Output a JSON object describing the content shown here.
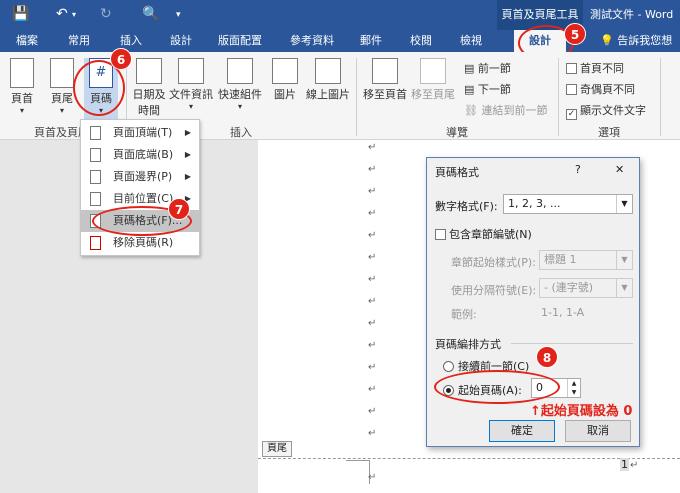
{
  "titlebar": {
    "context_tab": "頁首及頁尾工具",
    "document_title": "測試文件 - Word"
  },
  "tabs": [
    "檔案",
    "常用",
    "插入",
    "設計",
    "版面配置",
    "參考資料",
    "郵件",
    "校閱",
    "檢視"
  ],
  "tabs_context": {
    "design": "設計",
    "tell_me": "告訴我您想要"
  },
  "ribbon": {
    "header_footer_group": {
      "header": "頁首",
      "footer": "頁尾",
      "page_number": "頁碼",
      "label": "頁首及頁尾"
    },
    "insert_group": {
      "date_time_1": "日期及",
      "date_time_2": "時間",
      "doc_info": "文件資訊",
      "quick_parts": "快速組件",
      "picture": "圖片",
      "online_picture": "線上圖片",
      "label": "插入"
    },
    "nav_group": {
      "goto_header": "移至頁首",
      "goto_footer": "移至頁尾",
      "previous": "前一節",
      "next": "下一節",
      "link_previous": "連結到前一節",
      "label": "導覽"
    },
    "options_group": {
      "diff_first": "首頁不同",
      "diff_odd_even": "奇偶頁不同",
      "show_doc_text": "顯示文件文字",
      "label": "選項"
    }
  },
  "menu": {
    "items": [
      "頁面頂端(T)",
      "頁面底端(B)",
      "頁面邊界(P)",
      "目前位置(C)",
      "頁碼格式(F)...",
      "移除頁碼(R)"
    ]
  },
  "steps": {
    "s5": "5",
    "s6": "6",
    "s7": "7",
    "s8": "8"
  },
  "dialog": {
    "title": "頁碼格式",
    "help": "?",
    "close": "✕",
    "number_format_label": "數字格式(F):",
    "number_format_value": "1, 2, 3, ...",
    "include_chapter": "包含章節編號(N)",
    "chapter_style_label": "章節起始樣式(P):",
    "chapter_style_value": "標題 1",
    "separator_label": "使用分隔符號(E):",
    "separator_value": "-  (連字號)",
    "example_label": "範例:",
    "example_value": "1-1, 1-A",
    "numbering_section": "頁碼編排方式",
    "continue_prev": "接續前一節(C)",
    "start_at": "起始頁碼(A):",
    "start_value": "0",
    "ok": "確定",
    "cancel": "取消"
  },
  "annotation": "↑起始頁碼設為 0",
  "document": {
    "footer_tag": "頁尾",
    "page_num": "1"
  }
}
